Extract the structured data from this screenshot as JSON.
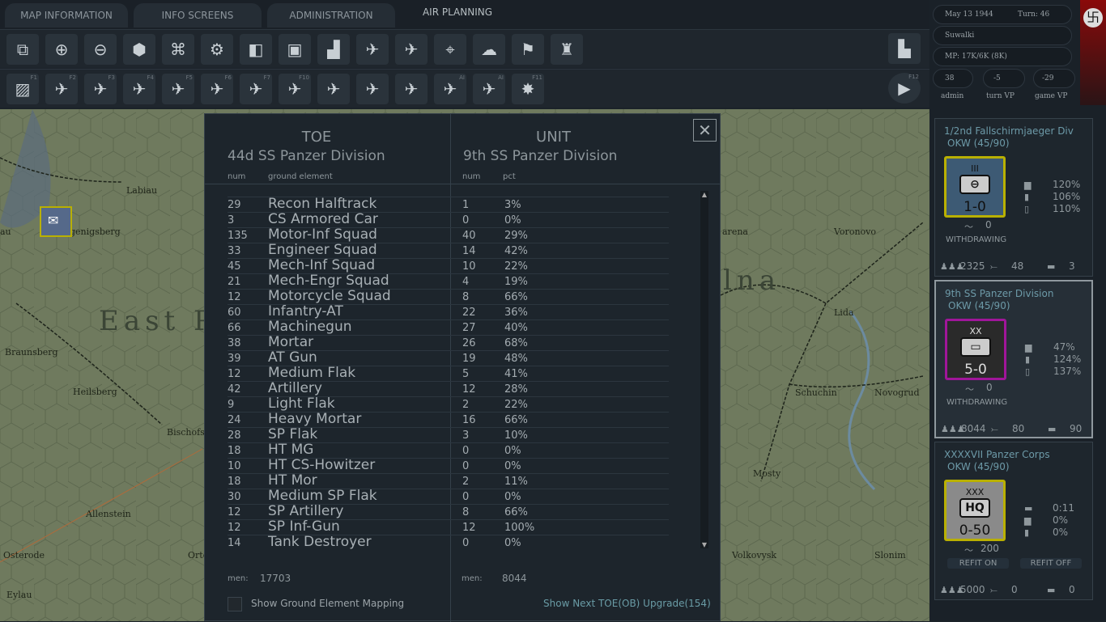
{
  "tabs": [
    "MAP INFORMATION",
    "INFO SCREENS",
    "ADMINISTRATION",
    "AIR PLANNING"
  ],
  "toolbar1": [
    "overlay-icon",
    "zoom-in-icon",
    "zoom-out-icon",
    "hex-icon",
    "supply-icon",
    "settings-icon",
    "unit-stack-icon",
    "display-icon",
    "factory-icon",
    "air-signal-icon",
    "air-bars-icon",
    "air-target-icon",
    "weather-icon",
    "flag-icon",
    "units-building-icon"
  ],
  "toolbar2": [
    {
      "icon": "ground-hatch-icon",
      "key": "F1"
    },
    {
      "icon": "air-ground-icon",
      "key": "F2"
    },
    {
      "icon": "air-strike-icon",
      "key": "F3"
    },
    {
      "icon": "air-city-icon",
      "key": "F4"
    },
    {
      "icon": "air-recon-icon",
      "key": "F5"
    },
    {
      "icon": "air-superiority-icon",
      "key": "F6"
    },
    {
      "icon": "naval-air-icon",
      "key": "F7"
    },
    {
      "icon": "air-transfer-icon",
      "key": "F10"
    },
    {
      "icon": "air-intercept-icon",
      "key": ""
    },
    {
      "icon": "air-base-icon",
      "key": ""
    },
    {
      "icon": "air-escort-icon",
      "key": ""
    },
    {
      "icon": "air-ai-strike-icon",
      "key": "AI"
    },
    {
      "icon": "air-ai-icon",
      "key": "AI"
    },
    {
      "icon": "explosion-icon",
      "key": "F11"
    }
  ],
  "status": {
    "date": "May 13 1944",
    "turn": "Turn: 46",
    "location": "Suwalki",
    "mp": "MP:  17K/6K (8K)",
    "admin": "38",
    "turn_vp": "-5",
    "game_vp": "-29",
    "admin_label": "admin",
    "turn_vp_label": "turn VP",
    "game_vp_label": "game VP"
  },
  "map_labels": [
    "Labiau",
    "genigsberg",
    "East P",
    "Braunsberg",
    "Heilsberg",
    "Bischofs",
    "Allenstein",
    "Osterode",
    "Orte",
    "Eylau",
    "au",
    "arena",
    "Voronovo",
    "lna",
    "Lida",
    "Schuchin",
    "Novogrud",
    "Mosty",
    "Volkovysk",
    "Slonim"
  ],
  "dialog": {
    "toe_title": "TOE",
    "toe_unit": "44d SS Panzer Division",
    "unit_title": "UNIT",
    "unit_name": "9th SS Panzer Division",
    "col_num": "num",
    "col_element": "ground element",
    "col_unum": "num",
    "col_pct": "pct",
    "rows": [
      [
        "29",
        "Recon Halftrack",
        "1",
        "3%"
      ],
      [
        "3",
        "CS Armored Car",
        "0",
        "0%"
      ],
      [
        "135",
        "Motor-Inf Squad",
        "40",
        "29%"
      ],
      [
        "33",
        "Engineer Squad",
        "14",
        "42%"
      ],
      [
        "45",
        "Mech-Inf Squad",
        "10",
        "22%"
      ],
      [
        "21",
        "Mech-Engr Squad",
        "4",
        "19%"
      ],
      [
        "12",
        "Motorcycle Squad",
        "8",
        "66%"
      ],
      [
        "60",
        "Infantry-AT",
        "22",
        "36%"
      ],
      [
        "66",
        "Machinegun",
        "27",
        "40%"
      ],
      [
        "38",
        "Mortar",
        "26",
        "68%"
      ],
      [
        "39",
        "AT Gun",
        "19",
        "48%"
      ],
      [
        "12",
        "Medium Flak",
        "5",
        "41%"
      ],
      [
        "42",
        "Artillery",
        "12",
        "28%"
      ],
      [
        "9",
        "Light Flak",
        "2",
        "22%"
      ],
      [
        "24",
        "Heavy Mortar",
        "16",
        "66%"
      ],
      [
        "28",
        "SP Flak",
        "3",
        "10%"
      ],
      [
        "18",
        "HT MG",
        "0",
        "0%"
      ],
      [
        "10",
        "HT CS-Howitzer",
        "0",
        "0%"
      ],
      [
        "18",
        "HT Mor",
        "2",
        "11%"
      ],
      [
        "30",
        "Medium SP Flak",
        "0",
        "0%"
      ],
      [
        "12",
        "SP Artillery",
        "8",
        "66%"
      ],
      [
        "12",
        "SP Inf-Gun",
        "12",
        "100%"
      ],
      [
        "14",
        "Tank Destroyer",
        "0",
        "0%"
      ]
    ],
    "men_label": "men:",
    "toe_men": "17703",
    "unit_men": "8044",
    "checkbox_label": "Show Ground Element Mapping",
    "upgrade_link": "Show Next TOE(OB) Upgrade(154)",
    "close": "✕"
  },
  "cards": [
    {
      "name": "1/2nd Fallschirmjaeger Div",
      "owner": "OKW   (45/90)",
      "echelon": "III",
      "symbol": "⊖",
      "strength": "1-0",
      "s1": "120%",
      "s2": "106%",
      "s3": "110%",
      "move": "0",
      "status": "WITHDRAWING",
      "men": "2325",
      "guns": "48",
      "tanks": "3",
      "color": "#3d5a74",
      "border": "#b9b000"
    },
    {
      "name": "9th SS Panzer Division",
      "owner": "OKW   (45/90)",
      "echelon": "XX",
      "symbol": "▭",
      "strength": "5-0",
      "s1": "47%",
      "s2": "124%",
      "s3": "137%",
      "move": "0",
      "status": "WITHDRAWING",
      "men": "8044",
      "guns": "80",
      "tanks": "90",
      "color": "#2a2a2a",
      "border": "#a0169a"
    },
    {
      "name": "XXXXVII Panzer Corps",
      "owner": "OKW   (45/90)",
      "echelon": "XXX",
      "symbol": "HQ",
      "strength": "0-50",
      "s1": "0:11",
      "s2": "0%",
      "s3": "0%",
      "move": "200",
      "refit_on": "REFIT ON",
      "refit_off": "REFIT OFF",
      "men": "5000",
      "guns": "0",
      "tanks": "0",
      "color": "#8a8a8a",
      "border": "#b9b000"
    }
  ]
}
